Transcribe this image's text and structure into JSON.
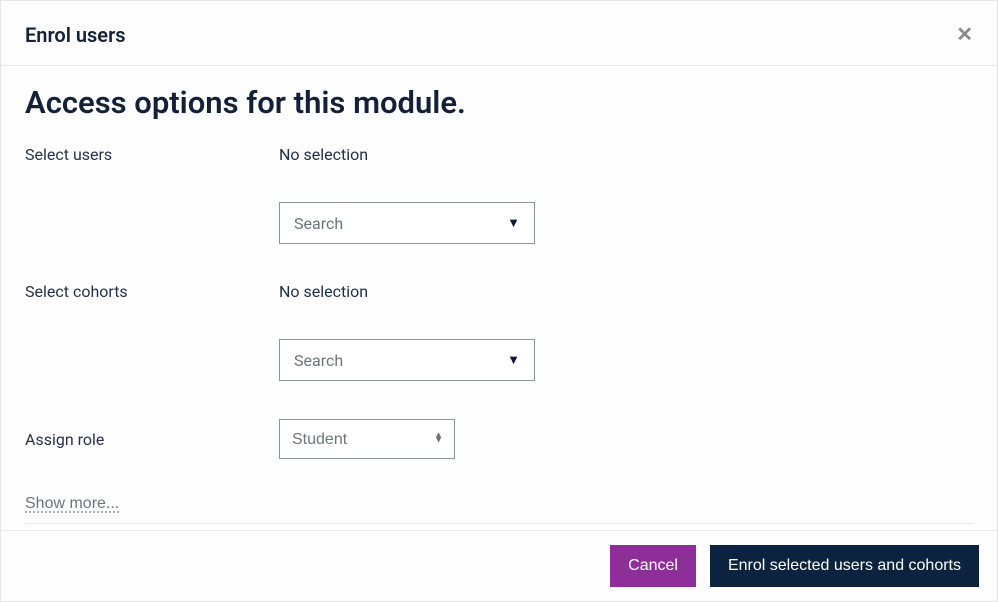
{
  "modal": {
    "title": "Enrol users",
    "heading": "Access options for this module."
  },
  "form": {
    "select_users": {
      "label": "Select users",
      "status": "No selection",
      "placeholder": "Search"
    },
    "select_cohorts": {
      "label": "Select cohorts",
      "status": "No selection",
      "placeholder": "Search"
    },
    "assign_role": {
      "label": "Assign role",
      "value": "Student"
    },
    "show_more": "Show more..."
  },
  "footer": {
    "cancel": "Cancel",
    "enrol": "Enrol selected users and cohorts"
  }
}
